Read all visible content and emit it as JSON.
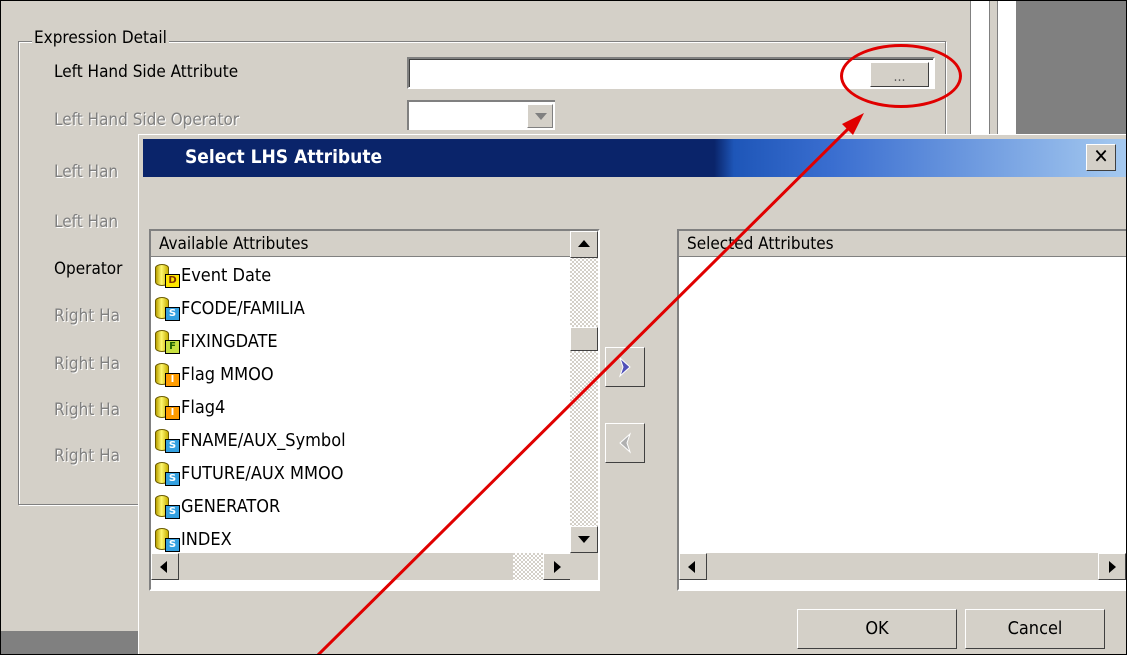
{
  "expression_detail": {
    "group_title": "Expression Detail",
    "lhs_attribute_label": "Left Hand Side Attribute",
    "lhs_attribute_value": "",
    "browse_button_label": "...",
    "lhs_operator_label": "Left Hand Side Operator",
    "lhs_row3_label": "Left Han",
    "lhs_row4_label": "Left Han",
    "operator_label": "Operator",
    "rhs_row1_label": "Right Ha",
    "rhs_row2_label": "Right Ha",
    "rhs_row3_label": "Right Ha",
    "rhs_row4_label": "Right Ha"
  },
  "dialog": {
    "title": "Select LHS Attribute",
    "close_label": "✕",
    "available_header": "Available Attributes",
    "selected_header": "Selected Attributes",
    "available_attributes": [
      {
        "label": "Event Date",
        "type": "D"
      },
      {
        "label": "FCODE/FAMILIA",
        "type": "S"
      },
      {
        "label": "FIXINGDATE",
        "type": "F"
      },
      {
        "label": "Flag MMOO",
        "type": "I"
      },
      {
        "label": "Flag4",
        "type": "I"
      },
      {
        "label": "FNAME/AUX_Symbol",
        "type": "S"
      },
      {
        "label": "FUTURE/AUX MMOO",
        "type": "S"
      },
      {
        "label": "GENERATOR",
        "type": "S"
      },
      {
        "label": "INDEX",
        "type": "S"
      }
    ],
    "selected_attributes": [],
    "ok_label": "OK",
    "cancel_label": "Cancel"
  },
  "annotation": {
    "highlight_color": "#e00000"
  },
  "colors": {
    "title_bar_start": "#0a246a",
    "title_bar_end": "#a6caf0",
    "window_face": "#d4d0c8"
  }
}
